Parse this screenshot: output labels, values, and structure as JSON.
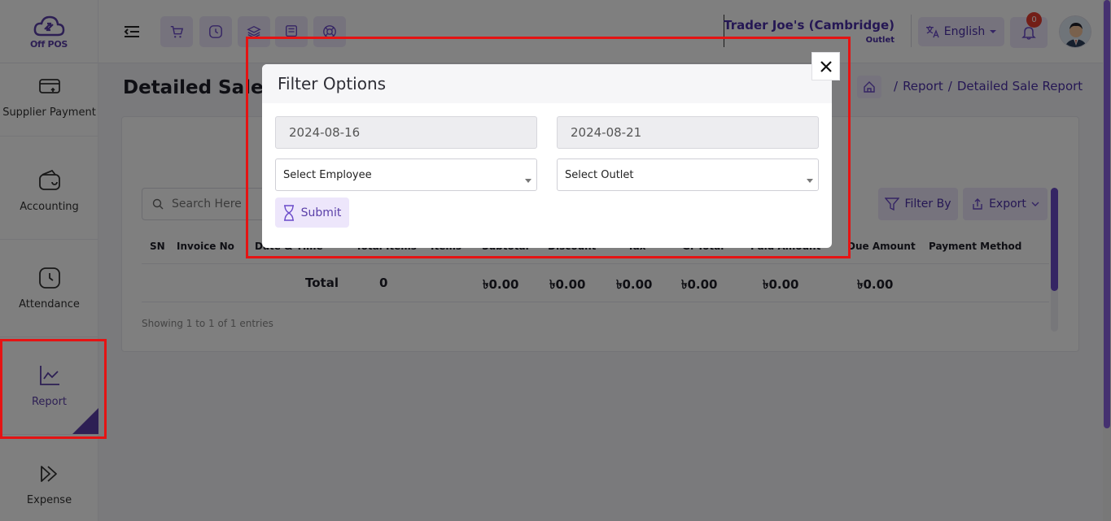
{
  "app": {
    "logo_text": "Off POS"
  },
  "header": {
    "outlet_name": "Trader Joe's (Cambridge)",
    "outlet_label": "Outlet",
    "language": "English",
    "notification_count": "0"
  },
  "sidebar": {
    "items": [
      {
        "label": "Supplier Payment",
        "icon": "supplier-payment-icon"
      },
      {
        "label": "Accounting",
        "icon": "wallet-icon"
      },
      {
        "label": "Attendance",
        "icon": "clock-icon"
      },
      {
        "label": "Report",
        "icon": "chart-icon",
        "active": true
      },
      {
        "label": "Expense",
        "icon": "expense-icon"
      }
    ]
  },
  "page": {
    "title": "Detailed Sale Re",
    "breadcrumb": [
      "Report",
      "Detailed Sale Report"
    ],
    "search_placeholder": "Search Here",
    "filter_label": "Filter By",
    "export_label": "Export",
    "table": {
      "headers": [
        "SN",
        "Invoice No",
        "Date & Time",
        "Total Items",
        "Items",
        "Subtotal",
        "Discount",
        "Tax",
        "G. Total",
        "Paid Amount",
        "Due Amount",
        "Payment Method"
      ],
      "footer": {
        "label": "Total",
        "total_items": "0",
        "subtotal": "৳0.00",
        "discount": "৳0.00",
        "tax": "৳0.00",
        "g_total": "৳0.00",
        "paid_amount": "৳0.00",
        "due_amount": "৳0.00"
      }
    },
    "showing": "Showing 1 to 1 of 1 entries"
  },
  "modal": {
    "title": "Filter Options",
    "start_date": "2024-08-16",
    "end_date": "2024-08-21",
    "employee_select": "Select Employee",
    "outlet_select": "Select Outlet",
    "submit_label": "Submit"
  },
  "colors": {
    "accent": "#5a3fa8",
    "accent_light": "#ede6fb",
    "highlight": "#e51313",
    "badge": "#e63d2f"
  }
}
